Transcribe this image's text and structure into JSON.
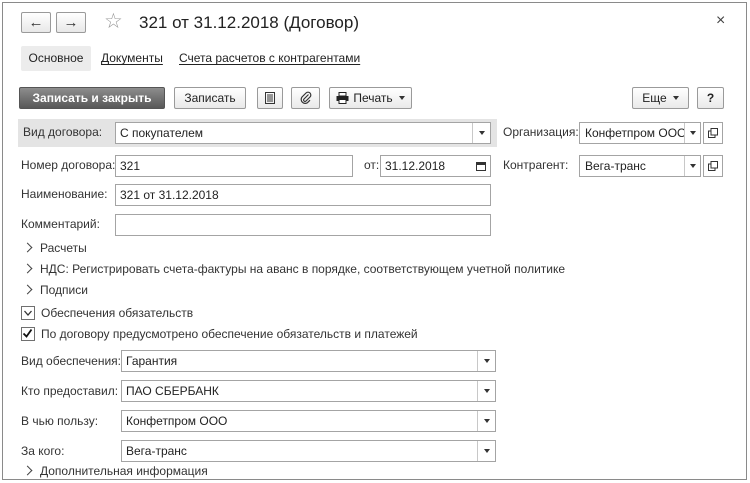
{
  "window": {
    "title": "321 от 31.12.2018 (Договор)",
    "back_glyph": "←",
    "forward_glyph": "→",
    "star_glyph": "☆",
    "close_glyph": "×"
  },
  "tabs": [
    {
      "label": "Основное",
      "active": true
    },
    {
      "label": "Документы",
      "active": false
    },
    {
      "label": "Счета расчетов с контрагентами",
      "active": false
    }
  ],
  "toolbar": {
    "save_close_label": "Записать и закрыть",
    "save_label": "Записать",
    "print_label": "Печать",
    "more_label": "Еще",
    "help_label": "?"
  },
  "icons": {
    "list": "list-icon",
    "attach": "paperclip-icon",
    "print": "printer-icon",
    "calendar": "calendar-icon"
  },
  "form": {
    "contract_type": {
      "label": "Вид договора:",
      "value": "С покупателем"
    },
    "organization": {
      "label": "Организация:",
      "value": "Конфетпром ООО"
    },
    "contract_number": {
      "label": "Номер договора:",
      "value": "321"
    },
    "date": {
      "label": "от:",
      "value": "31.12.2018"
    },
    "counterparty": {
      "label": "Контрагент:",
      "value": "Вега-транс"
    },
    "name": {
      "label": "Наименование:",
      "value": "321 от 31.12.2018"
    },
    "comment": {
      "label": "Комментарий:",
      "value": ""
    }
  },
  "groups": {
    "payments": "Расчеты",
    "vat": "НДС: Регистрировать счета-фактуры на аванс в порядке, соответствующем учетной политике",
    "signatures": "Подписи",
    "obligations": "Обеспечения обязательств",
    "additional": "Дополнительная информация"
  },
  "security": {
    "checkbox_label": "По договору предусмотрено обеспечение обязательств и платежей",
    "checked": true,
    "type": {
      "label": "Вид обеспечения:",
      "value": "Гарантия"
    },
    "provider": {
      "label": "Кто предоставил:",
      "value": "ПАО СБЕРБАНК"
    },
    "beneficiary": {
      "label": "В чью пользу:",
      "value": "Конфетпром ООО"
    },
    "for_whom": {
      "label": "За кого:",
      "value": "Вега-транс"
    }
  }
}
